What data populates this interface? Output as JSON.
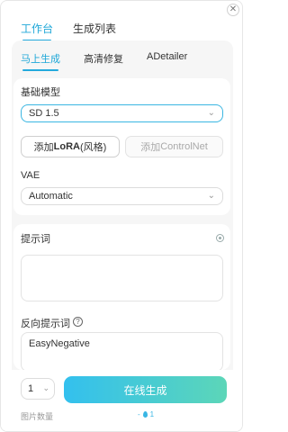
{
  "tabs": {
    "top": [
      {
        "label": "工作台",
        "active": true
      },
      {
        "label": "生成列表",
        "active": false
      }
    ],
    "sub": [
      {
        "label": "马上生成",
        "active": true
      },
      {
        "label": "高清修复",
        "active": false
      },
      {
        "label": "ADetailer",
        "active": false
      }
    ]
  },
  "model": {
    "label": "基础模型",
    "selected": "SD 1.5"
  },
  "buttons": {
    "lora_prefix": "添加 ",
    "lora_bold": "LoRA",
    "lora_suffix": "(风格)",
    "controlnet_prefix": "添加 ",
    "controlnet_bold": "ControlNet"
  },
  "vae": {
    "label": "VAE",
    "selected": "Automatic"
  },
  "prompt": {
    "label": "提示词",
    "value": ""
  },
  "negative_prompt": {
    "label": "反向提示词",
    "value": "EasyNegative"
  },
  "footer": {
    "count_value": "1",
    "count_label": "图片数量",
    "generate_label": "在线生成",
    "cost_sign": "-",
    "cost_value": "1"
  },
  "colors": {
    "accent": "#1ea7d8",
    "generate_gradient_start": "#33c0ee",
    "generate_gradient_end": "#5cd6b8"
  }
}
